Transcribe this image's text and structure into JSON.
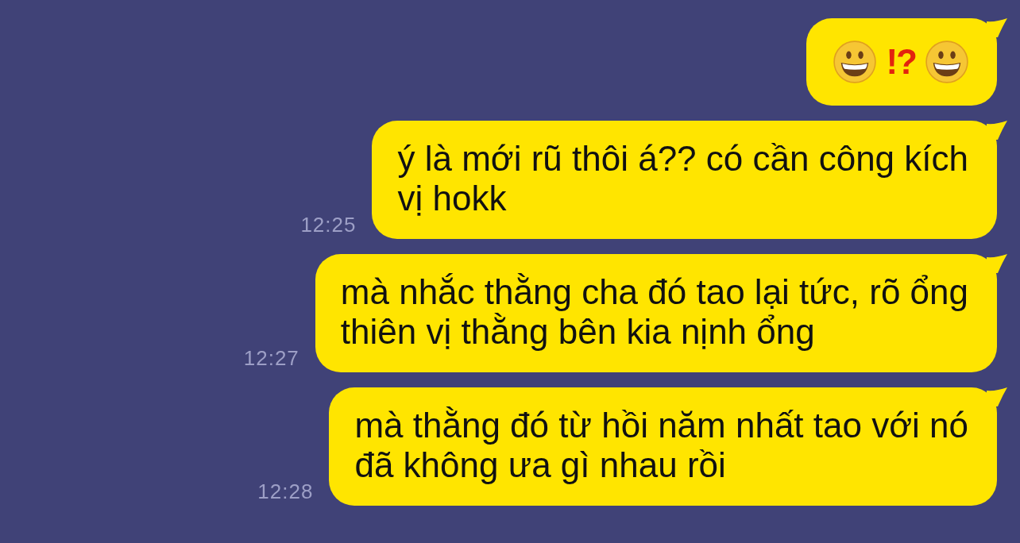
{
  "messages": [
    {
      "kind": "emoji",
      "parts": [
        {
          "kind": "smiley"
        },
        {
          "kind": "text",
          "text": "!?"
        },
        {
          "kind": "smiley"
        }
      ]
    },
    {
      "kind": "text",
      "time": "12:25",
      "lines": [
        "ý là mới rũ thôi á?? có cần công kích",
        "vị hokk"
      ]
    },
    {
      "kind": "text",
      "time": "12:27",
      "lines": [
        "mà nhắc thằng cha đó tao lại tức, rõ ổng",
        "thiên vị thằng bên kia nịnh ổng"
      ]
    },
    {
      "kind": "text",
      "time": "12:28",
      "lines": [
        "mà thằng đó từ hồi năm nhất tao với nó",
        "đã không ưa gì nhau rồi"
      ]
    }
  ]
}
